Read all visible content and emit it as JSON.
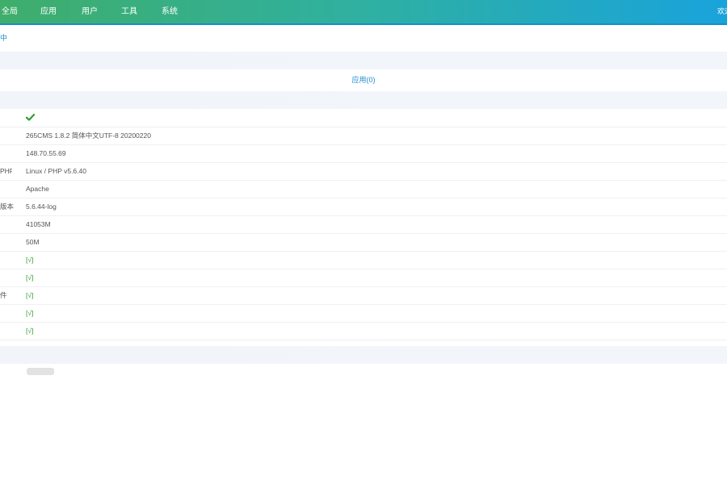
{
  "nav": {
    "items": [
      "全局",
      "应用",
      "用户",
      "工具",
      "系统"
    ],
    "right_label": "欢迎"
  },
  "breadcrumb": "中心",
  "apps": {
    "label": "应用",
    "count": "(0)"
  },
  "info": {
    "status_icon": "check-icon",
    "version": "265CMS 1.8.2 简体中文UTF-8 20200220",
    "ip": "148.70.55.69",
    "os_php_label": "PHP",
    "os_php": "Linux / PHP v5.6.40",
    "web_server": "Apache",
    "db_version_label": "版本",
    "db_version": "5.6.44-log",
    "disk": "41053M",
    "upload": "50M",
    "flag_1": "[√]",
    "flag_2": "[√]",
    "flag_3_label": "件",
    "flag_3": "[√]",
    "flag_4": "[√]",
    "flag_5": "[√]"
  },
  "colors": {
    "topbar_start": "#3fae6b",
    "topbar_end": "#19a3dc",
    "link": "#1a8ccf",
    "ok": "#2e9e2e",
    "band": "#f1f5fa"
  }
}
